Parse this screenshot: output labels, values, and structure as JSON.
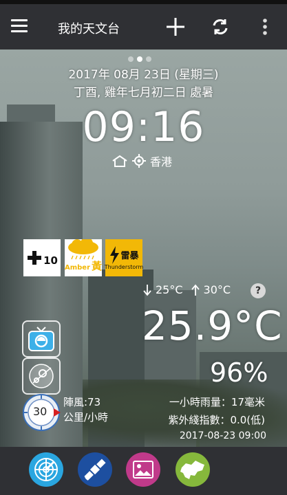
{
  "app": {
    "title": "我的天文台"
  },
  "toolbar": {
    "menu_icon": "hamburger-icon",
    "add_icon": "plus-icon",
    "refresh_icon": "refresh-icon",
    "more_icon": "more-vert-icon"
  },
  "pager": {
    "count": 3,
    "active": 1
  },
  "date": {
    "gregorian": "2017年 08月 23日 (星期三)",
    "lunar": "丁酉, 雞年七月初二日 處暑"
  },
  "clock": {
    "time": "09:16"
  },
  "location": {
    "name": "香港",
    "home_icon": "home-icon",
    "gps_icon": "location-icon"
  },
  "warnings": [
    {
      "name": "strong-monsoon-signal",
      "label": "10"
    },
    {
      "name": "amber-rainstorm-signal",
      "label": "Amber",
      "label_zh": "黃"
    },
    {
      "name": "thunderstorm-warning",
      "label_zh": "雷暴",
      "label": "Thunderstorm"
    }
  ],
  "forecast": {
    "min": "25°C",
    "max": "30°C",
    "help": "?"
  },
  "weather": {
    "temperature": "25.9°C",
    "humidity": "96%",
    "rainfall": "一小時雨量：17毫米",
    "uv": "紫外綫指數：0.0(低)",
    "updated": "2017-08-23 09:00"
  },
  "wind": {
    "speed": "30",
    "gust": "陣風:73",
    "unit": "公里/小時"
  },
  "bottom_nav": [
    {
      "name": "radar-button",
      "color": "#2aa6e0"
    },
    {
      "name": "satellite-button",
      "color": "#1d4fa0"
    },
    {
      "name": "gallery-button",
      "color": "#c03a8a"
    },
    {
      "name": "map-button",
      "color": "#86b83c"
    }
  ],
  "colors": {
    "toolbar": "#2f3034",
    "amber": "#f2b807",
    "warning_red": "#d62020"
  }
}
